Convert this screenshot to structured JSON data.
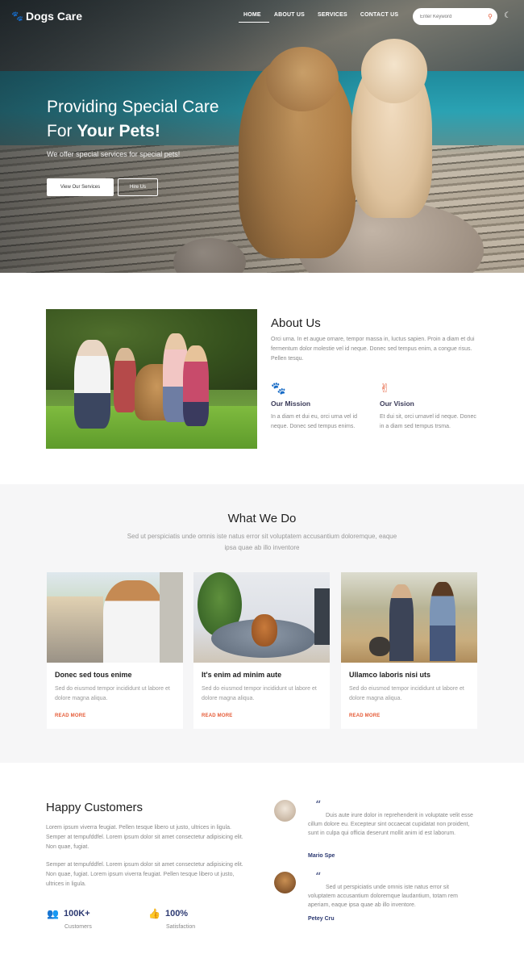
{
  "nav": {
    "logo": "Dogs Care",
    "items": [
      "HOME",
      "ABOUT US",
      "SERVICES",
      "CONTACT US"
    ],
    "search_placeholder": "Enter Keyword"
  },
  "hero": {
    "title_line1": "Providing Special Care",
    "title_line2_prefix": "For ",
    "title_line2_bold": "Your Pets!",
    "subtitle": "We offer special services for special pets!",
    "btn_primary": "View Our Services",
    "btn_secondary": "Hire Us"
  },
  "about": {
    "title": "About Us",
    "text": "Orci urna. In et augue ornare, tempor massa in, luctus sapien. Proin a diam et dui fermentum dolor molestie vel id neque. Donec sed tempus enim, a congue risus. Pellen tesqu.",
    "features": [
      {
        "title": "Our Mission",
        "text": "In a diam et dui eu, orci urna vel id neque. Donec sed tempus enims.",
        "icon": "paw-icon"
      },
      {
        "title": "Our Vision",
        "text": "Et dui sit, orci urnavel id neque. Donec in a diam sed tempus trsma.",
        "icon": "peace-hand-icon"
      }
    ]
  },
  "what_we_do": {
    "title": "What We Do",
    "subtitle": "Sed ut perspiciatis unde omnis iste natus error sit voluptatem accusantium doloremque, eaque ipsa quae ab illo inventore",
    "cards": [
      {
        "title": "Donec sed tous enime",
        "text": "Sed do eiusmod tempor incididunt ut labore et dolore magna aliqua.",
        "link": "READ MORE"
      },
      {
        "title": "It's enim ad minim aute",
        "text": "Sed do eiusmod tempor incididunt ut labore et dolore magna aliqua.",
        "link": "READ MORE"
      },
      {
        "title": "Ullamco laboris nisi uts",
        "text": "Sed do eiusmod tempor incididunt ut labore et dolore magna aliqua.",
        "link": "READ MORE"
      }
    ]
  },
  "customers": {
    "title": "Happy Customers",
    "para1": "Lorem ipsum viverra feugiat. Pellen tesque libero ut justo, ultrices in ligula. Semper at tempufddfel. Lorem ipsum dolor sit amet consectetur adipisicing elit. Non quae, fugiat.",
    "para2": "Semper at tempufddfel. Lorem ipsum dolor sit amet consectetur adipisicing elit. Non quae, fugiat. Lorem ipsum viverra feugiat. Pellen tesque libero ut justo, ultrices in ligula.",
    "stats": [
      {
        "value": "100K+",
        "label": "Customers",
        "icon": "users-plus-icon"
      },
      {
        "value": "100%",
        "label": "Satisfaction",
        "icon": "thumbs-up-icon"
      }
    ],
    "testimonials": [
      {
        "quote": "Duis aute irure dolor in reprehenderit in voluptate velit esse cillum dolore eu. Excepteur sint occaecat cupidatat non proident, sunt in culpa qui officia deserunt mollit anim id est laborum.",
        "name": "Mario Spe"
      },
      {
        "quote": "Sed ut perspiciatis unde omnis iste natus error sit voluptatem accusantium doloremque laudantium, totam rem aperiam, eaque ipsa quae ab illo inventore.",
        "name": "Petey Cru"
      }
    ]
  },
  "colors": {
    "accent": "#e55a36",
    "navy": "#2d3a72"
  }
}
